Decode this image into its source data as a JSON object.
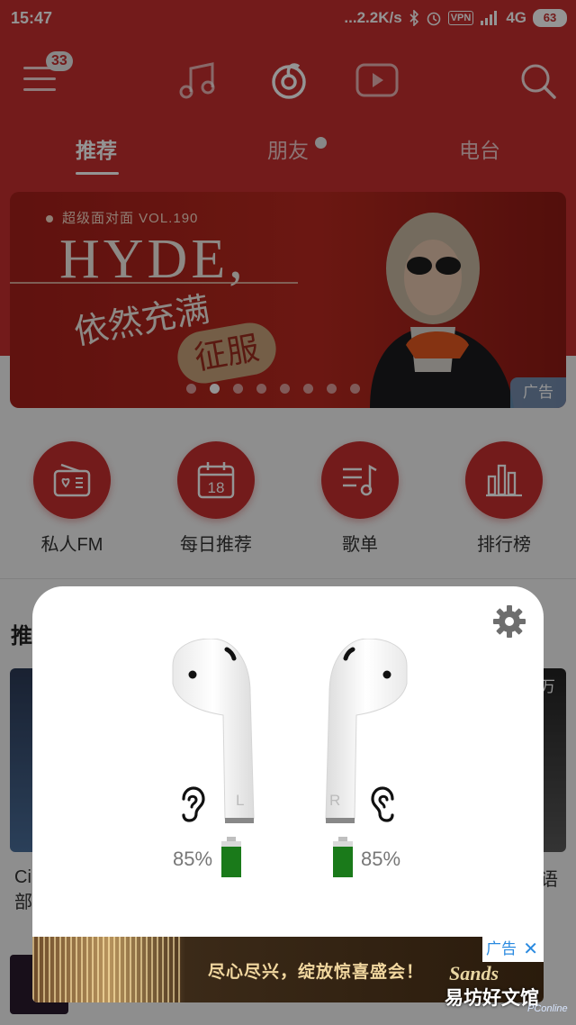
{
  "status_bar": {
    "time": "15:47",
    "net_speed": "...2.2K/s",
    "vpn": "VPN",
    "network": "4G",
    "battery": "63"
  },
  "topnav": {
    "menu_badge": "33",
    "icons": [
      "menu-icon",
      "music-note-icon",
      "netease-logo-icon",
      "video-play-icon",
      "search-icon"
    ]
  },
  "tabs": [
    {
      "label": "推荐",
      "active": true
    },
    {
      "label": "朋友",
      "active": false
    },
    {
      "label": "电台",
      "active": false
    }
  ],
  "banner": {
    "subtitle": "超级面对面 VOL.190",
    "title": "HYDE,",
    "phrase": "依然充满",
    "conquer": "征服",
    "ad_label": "广告",
    "active_dot": 1,
    "dot_count": 8
  },
  "quick_actions": [
    {
      "label": "私人FM",
      "icon": "radio-icon"
    },
    {
      "label": "每日推荐",
      "icon": "calendar-icon",
      "day": "18"
    },
    {
      "label": "歌单",
      "icon": "playlist-icon"
    },
    {
      "label": "排行榜",
      "icon": "chart-bars-icon"
    }
  ],
  "background": {
    "heading": "推",
    "left_text_1": "Ci",
    "left_text_2": "部",
    "right_top": "万",
    "right_text": "语"
  },
  "popup": {
    "left_letter": "L",
    "right_letter": "R",
    "left_battery": "85%",
    "right_battery": "85%",
    "left_level": 0.85,
    "right_level": 0.85,
    "battery_color": "#1a7a1a"
  },
  "ad": {
    "text": "尽心尽兴，绽放惊喜盛会！",
    "brand": "Sands",
    "label": "广告",
    "close": "✕"
  },
  "watermark": {
    "text": "易坊好文馆",
    "small": "PConline"
  }
}
